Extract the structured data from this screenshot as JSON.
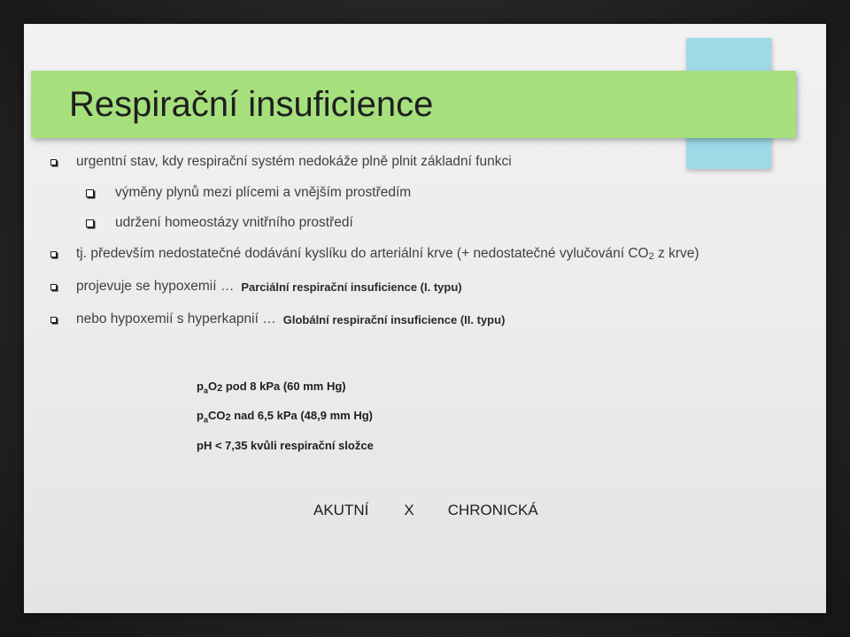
{
  "slide": {
    "title": "Respirační insuficience",
    "bullets": [
      {
        "text": "urgentní stav, kdy respirační systém nedokáže plně plnit základní funkci"
      },
      {
        "text": "výměny plynů mezi plícemi a vnějším prostředím"
      },
      {
        "text": "udržení homeostázy vnitřního prostředí"
      },
      {
        "text_before": "tj. především nedostatečné dodávání kyslíku do arteriální krve (+ nedostatečné vylučování CO",
        "sub": "2",
        "text_after": " z krve)"
      },
      {
        "text": "projevuje se hypoxemií …",
        "bold": "Parciální respirační insuficience (I. typu)"
      },
      {
        "text": "nebo hypoxemií s hyperkapnií …",
        "bold": "Globální respirační insuficience (II. typu)"
      }
    ],
    "criteria": [
      {
        "p": "p",
        "a": "a",
        "gas": "O",
        "two": "2",
        "rest": " pod 8 kPa (60 mm Hg)"
      },
      {
        "p": "p",
        "a": "a",
        "gas": "CO",
        "two": "2",
        "rest": " nad 6,5 kPa (48,9 mm Hg)"
      },
      {
        "text": "pH < 7,35 kvůli respirační složce"
      }
    ],
    "comparison": {
      "left": "AKUTNÍ",
      "mid": "X",
      "right": "CHRONICKÁ"
    }
  },
  "colors": {
    "title_bar": "#a5e07c",
    "accent_box": "#9ed9e8",
    "background": "#262626"
  }
}
